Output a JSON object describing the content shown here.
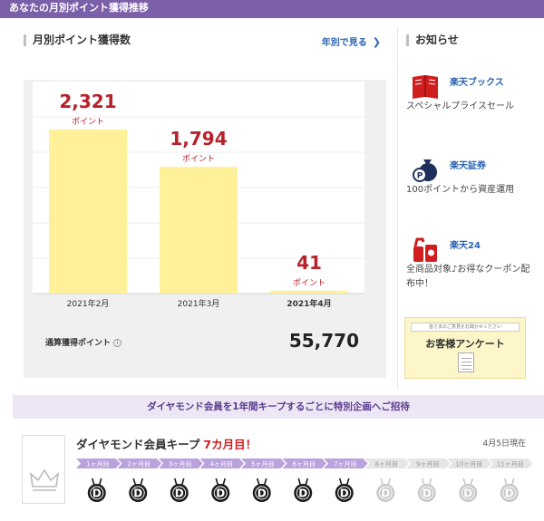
{
  "header": {
    "title": "あなたの月別ポイント獲得推移"
  },
  "main": {
    "section_title": "月別ポイント獲得数",
    "yearly_link": "年別で見る",
    "point_unit": "ポイント",
    "total_label": "通算獲得ポイント",
    "info_icon_glyph": "i",
    "total_value": "55,770"
  },
  "chart_data": {
    "type": "bar",
    "categories": [
      "2021年2月",
      "2021年3月",
      "2021年4月"
    ],
    "values": [
      2321,
      1794,
      41
    ],
    "value_labels": [
      "2,321",
      "1,794",
      "41"
    ],
    "highlight_index": 2,
    "ylim": [
      0,
      3000
    ],
    "grid": true,
    "bar_color": "#fff199",
    "value_color": "#b8202a",
    "title": "",
    "xlabel": "",
    "ylabel": ""
  },
  "sidebar": {
    "title": "お知らせ",
    "items": [
      {
        "name": "楽天ブックス",
        "desc": "スペシャルプライスセール",
        "icon": "book-icon"
      },
      {
        "name": "楽天証券",
        "desc": "100ポイントから資産運用",
        "icon": "money-bag-icon"
      },
      {
        "name": "楽天24",
        "desc": "全商品対象♪お得なクーポン配布中！",
        "icon": "household-goods-icon"
      }
    ],
    "survey": {
      "small_text": "皆さまのご意見をお聞かせください",
      "big_text": "お客様アンケート"
    }
  },
  "banner": {
    "text": "ダイヤモンド会員を1年間キープするごとに特別企画へご招待"
  },
  "keep": {
    "title": "ダイヤモンド会員キープ",
    "month": "7カ月目！",
    "date": "4月5日現在",
    "months": [
      "1ヶ月目",
      "2ヶ月目",
      "3ヶ月目",
      "4ヶ月目",
      "5ヶ月目",
      "6ヶ月目",
      "7ヶ月目",
      "8ヶ月目",
      "9ヶ月目",
      "10ヶ月目",
      "11ヶ月目"
    ],
    "achieved": 7,
    "medal_letter": "D"
  },
  "colors": {
    "header_bg": "#7b5fa8",
    "link": "#2a62b0",
    "accent_red": "#d01e1e",
    "progress_done": "#b9a3dc",
    "progress_todo": "#e6e6e6",
    "medal_done": "#1a1a1a",
    "medal_todo": "#c8c8c8"
  }
}
